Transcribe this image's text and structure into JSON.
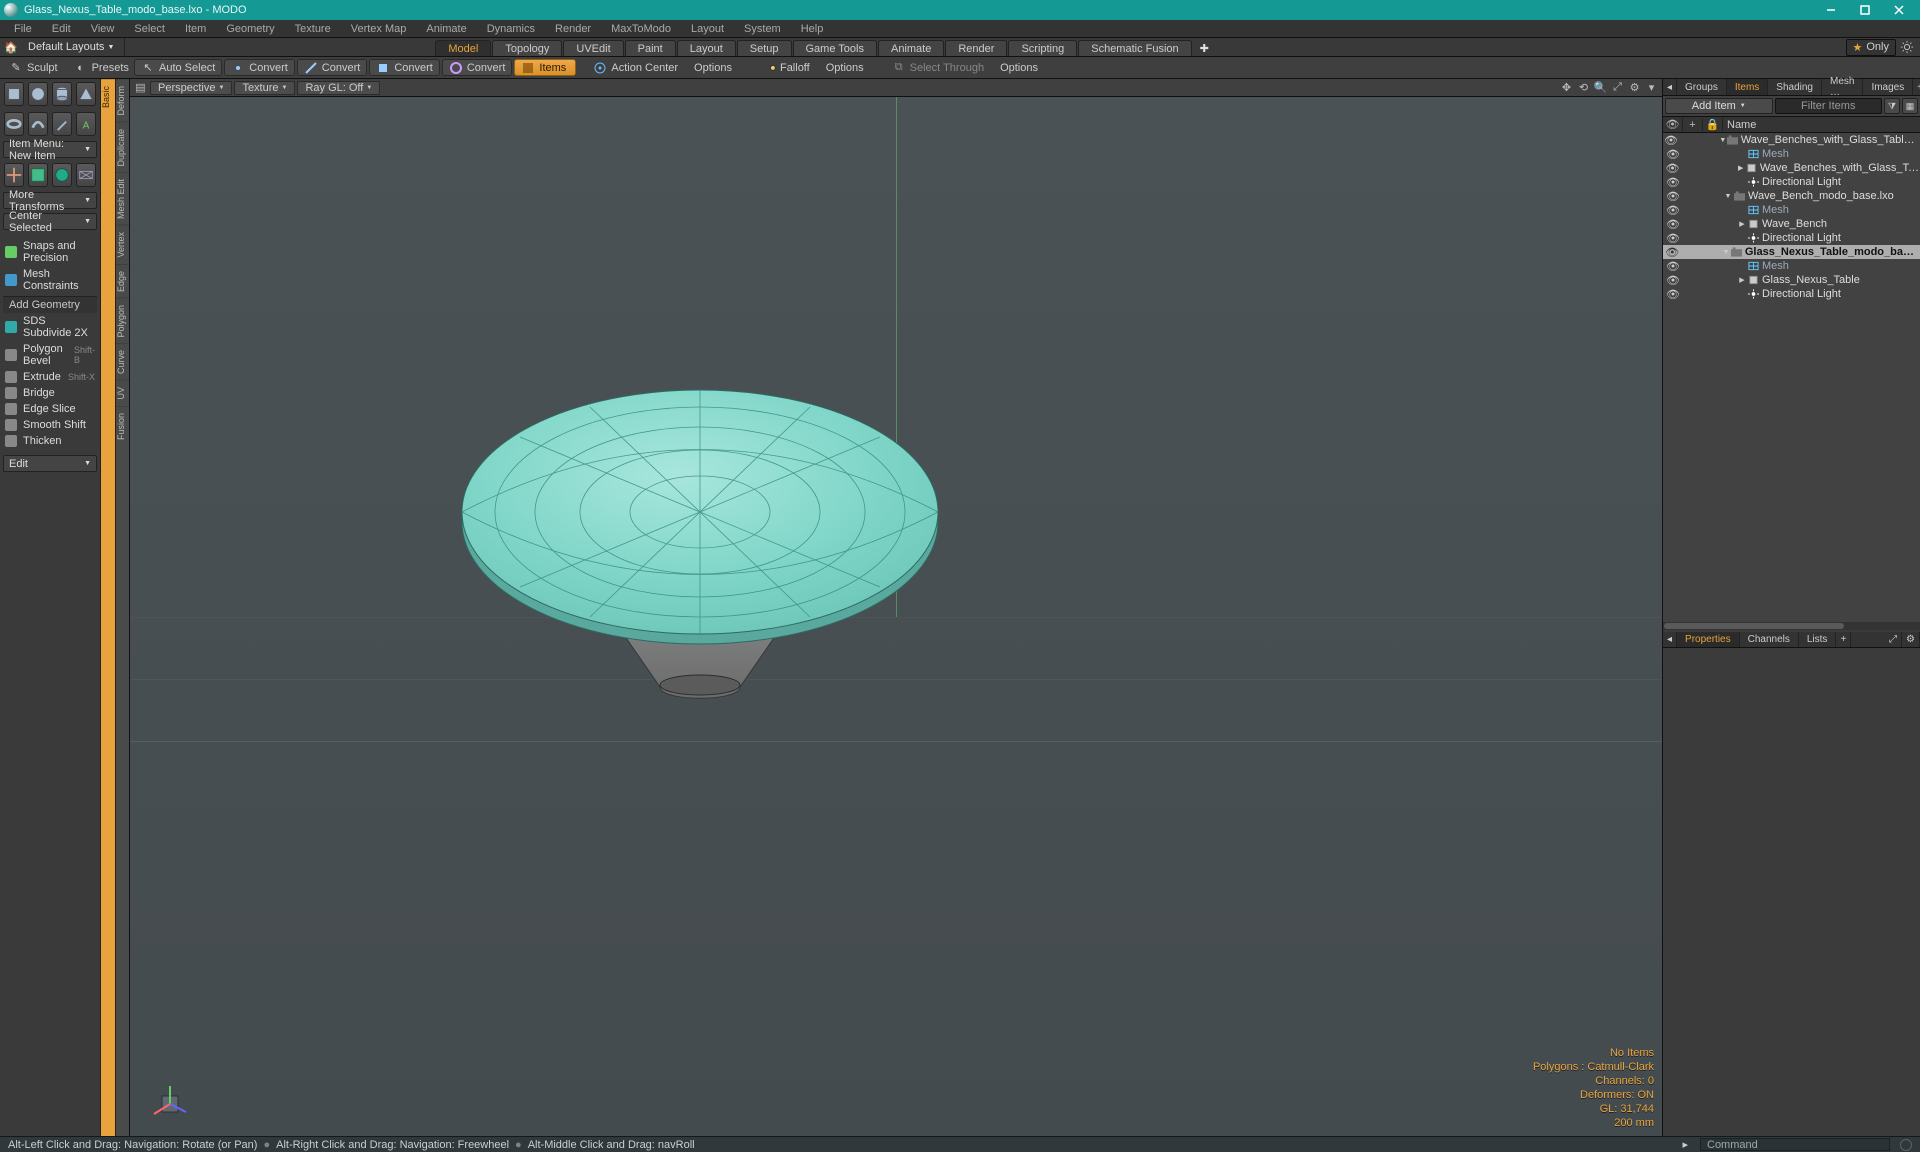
{
  "window": {
    "title": "Glass_Nexus_Table_modo_base.lxo - MODO"
  },
  "menubar": [
    "File",
    "Edit",
    "View",
    "Select",
    "Item",
    "Geometry",
    "Texture",
    "Vertex Map",
    "Animate",
    "Dynamics",
    "Render",
    "MaxToModo",
    "Layout",
    "System",
    "Help"
  ],
  "layoutbar": {
    "dropdown": "Default Layouts",
    "tabs": [
      "Model",
      "Topology",
      "UVEdit",
      "Paint",
      "Layout",
      "Setup",
      "Game Tools",
      "Animate",
      "Render",
      "Scripting",
      "Schematic Fusion"
    ],
    "active_tab": 0,
    "only_label": "Only"
  },
  "tool_top": {
    "sculpt": "Sculpt",
    "presets": "Presets",
    "auto_select": "Auto Select",
    "convert": "Convert",
    "convert2": "Convert",
    "convert3": "Convert",
    "convert4": "Convert",
    "items": "Items",
    "action_center": "Action Center",
    "options1": "Options",
    "falloff": "Falloff",
    "options2": "Options",
    "select_through": "Select Through",
    "options3": "Options"
  },
  "left_tabs_primary": [
    "Basic",
    "Deform",
    "Duplicate",
    "Mesh Edit",
    "Vertex",
    "Edge",
    "Polygon",
    "Curve",
    "UV",
    "Fusion"
  ],
  "left_tools": {
    "item_menu": "Item Menu: New Item",
    "more_transforms": "More Transforms",
    "center_selected": "Center Selected",
    "snaps": "Snaps and Precision",
    "mesh_constraints": "Mesh Constraints",
    "add_geometry": "Add Geometry",
    "items": [
      {
        "label": "SDS Subdivide 2X",
        "sc": ""
      },
      {
        "label": "Polygon Bevel",
        "sc": "Shift-B"
      },
      {
        "label": "Extrude",
        "sc": "Shift-X"
      },
      {
        "label": "Bridge",
        "sc": ""
      },
      {
        "label": "Edge Slice",
        "sc": ""
      },
      {
        "label": "Smooth Shift",
        "sc": ""
      },
      {
        "label": "Thicken",
        "sc": ""
      }
    ],
    "edit": "Edit"
  },
  "viewport": {
    "perspective": "Perspective",
    "texture": "Texture",
    "raygl": "Ray GL: Off",
    "status": {
      "no_items": "No Items",
      "polygons": "Polygons : Catmull-Clark",
      "channels": "Channels: 0",
      "deformers": "Deformers: ON",
      "gl": "GL: 31,744",
      "scale": "200 mm"
    }
  },
  "right": {
    "tabs1": [
      "Groups",
      "Items",
      "Shading",
      "Mesh …",
      "Images"
    ],
    "tabs1_active": 1,
    "add_item": "Add Item",
    "filter": "Filter Items",
    "name_header": "Name",
    "tree": [
      {
        "depth": 0,
        "type": "scene",
        "exp": "open",
        "label": "Wave_Benches_with_Glass_Table_modo_b…"
      },
      {
        "depth": 1,
        "type": "mesh",
        "exp": "none",
        "label": "Mesh",
        "dim": true
      },
      {
        "depth": 1,
        "type": "item",
        "exp": "closed",
        "label": "Wave_Benches_with_Glass_Table"
      },
      {
        "depth": 1,
        "type": "light",
        "exp": "none",
        "label": "Directional Light"
      },
      {
        "depth": 0,
        "type": "scene",
        "exp": "open",
        "label": "Wave_Bench_modo_base.lxo"
      },
      {
        "depth": 1,
        "type": "mesh",
        "exp": "none",
        "label": "Mesh",
        "dim": true
      },
      {
        "depth": 1,
        "type": "item",
        "exp": "closed",
        "label": "Wave_Bench"
      },
      {
        "depth": 1,
        "type": "light",
        "exp": "none",
        "label": "Directional Light"
      },
      {
        "depth": 0,
        "type": "scene",
        "exp": "open",
        "label": "Glass_Nexus_Table_modo_base.lxo",
        "selected": true
      },
      {
        "depth": 1,
        "type": "mesh",
        "exp": "none",
        "label": "Mesh",
        "dim": true
      },
      {
        "depth": 1,
        "type": "item",
        "exp": "closed",
        "label": "Glass_Nexus_Table"
      },
      {
        "depth": 1,
        "type": "light",
        "exp": "none",
        "label": "Directional Light"
      }
    ],
    "tabs2": [
      "Properties",
      "Channels",
      "Lists"
    ],
    "tabs2_active": 0
  },
  "helpbar": {
    "h1": "Alt-Left Click and Drag: Navigation: Rotate (or Pan)",
    "h2": "Alt-Right Click and Drag: Navigation: Freewheel",
    "h3": "Alt-Middle Click and Drag: navRoll",
    "cmd_placeholder": "Command"
  }
}
